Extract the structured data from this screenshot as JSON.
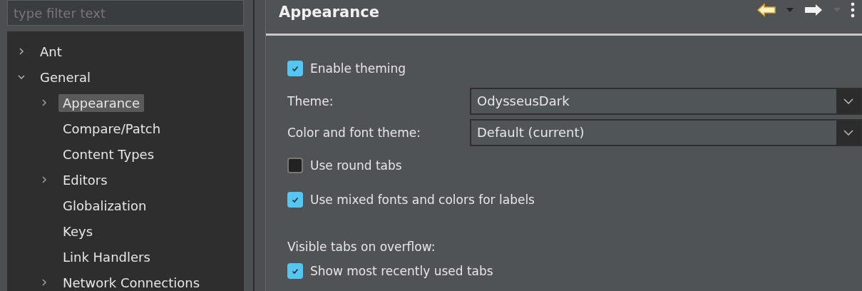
{
  "filter": {
    "placeholder": "type filter text"
  },
  "tree": [
    {
      "label": "Ant",
      "expanded": false,
      "selected": false
    },
    {
      "label": "General",
      "expanded": true,
      "selected": false,
      "children": [
        {
          "label": "Appearance",
          "expandable": true,
          "selected": true
        },
        {
          "label": "Compare/Patch",
          "expandable": false,
          "selected": false
        },
        {
          "label": "Content Types",
          "expandable": false,
          "selected": false
        },
        {
          "label": "Editors",
          "expandable": true,
          "selected": false
        },
        {
          "label": "Globalization",
          "expandable": false,
          "selected": false
        },
        {
          "label": "Keys",
          "expandable": false,
          "selected": false
        },
        {
          "label": "Link Handlers",
          "expandable": false,
          "selected": false
        },
        {
          "label": "Network Connections",
          "expandable": true,
          "selected": false
        }
      ]
    }
  ],
  "page": {
    "title": "Appearance"
  },
  "settings": [
    {
      "kind": "checkbox",
      "label": "Enable theming",
      "checked": true
    },
    {
      "kind": "select",
      "label": "Theme:",
      "value": "OdysseusDark"
    },
    {
      "kind": "select",
      "label": "Color and font theme:",
      "value": "Default (current)"
    },
    {
      "kind": "checkbox",
      "label": "Use round tabs",
      "checked": false
    },
    {
      "kind": "checkbox",
      "label": "Use mixed fonts and colors for labels",
      "checked": true
    },
    {
      "kind": "heading",
      "label": "Visible tabs on overflow:"
    },
    {
      "kind": "checkbox",
      "label": "Show most recently used tabs",
      "checked": true
    }
  ]
}
